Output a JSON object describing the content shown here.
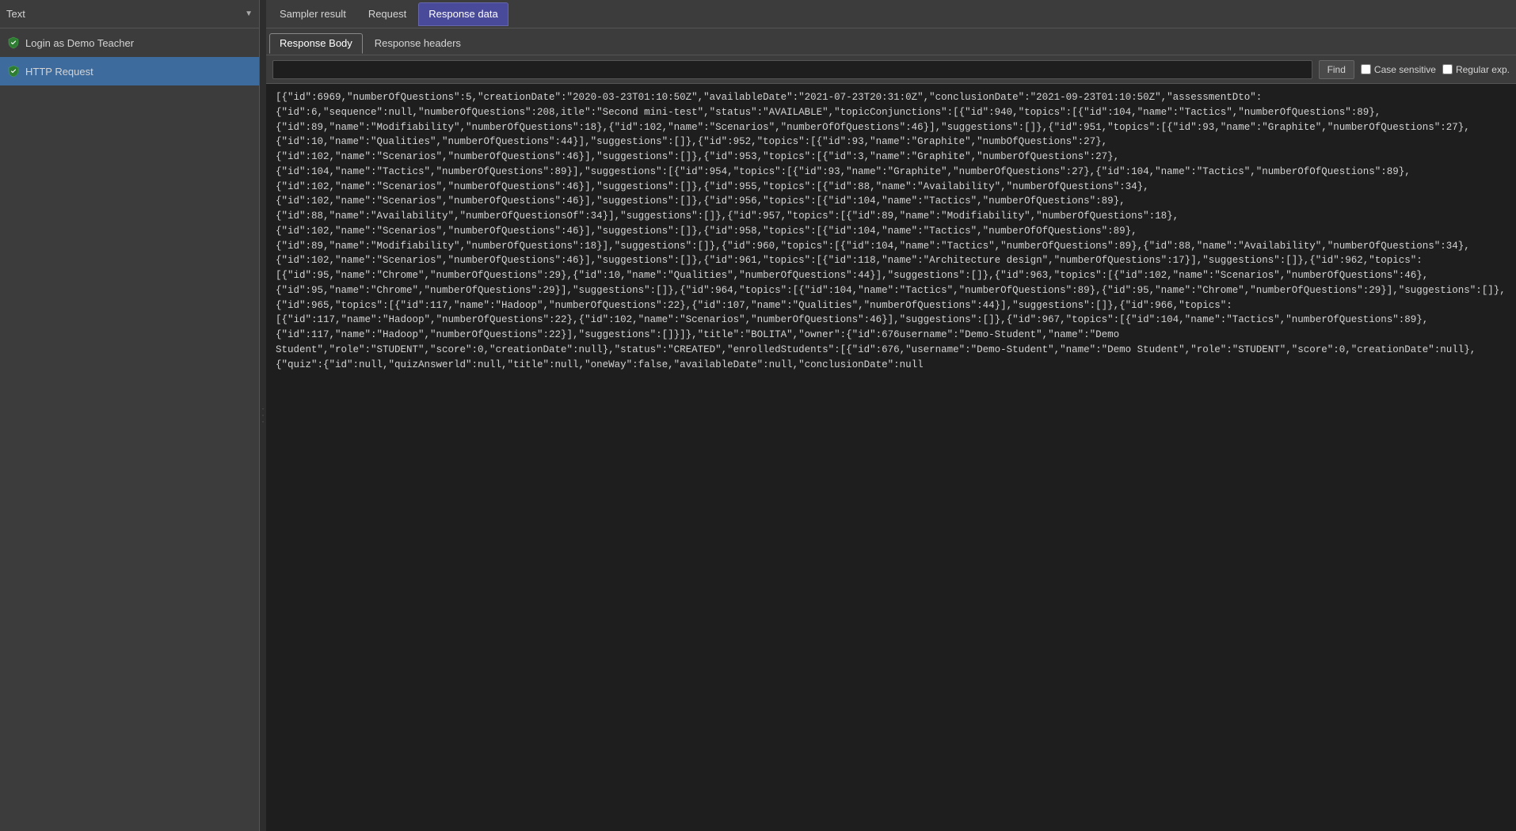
{
  "sidebar": {
    "title": "Text",
    "dropdown_arrow": "▼",
    "items": [
      {
        "id": "login-demo-teacher",
        "label": "Login as Demo Teacher",
        "active": false,
        "has_shield": true
      },
      {
        "id": "http-request",
        "label": "HTTP Request",
        "active": true,
        "has_shield": true
      }
    ]
  },
  "top_tabs": [
    {
      "id": "sampler-result",
      "label": "Sampler result",
      "active": false
    },
    {
      "id": "request",
      "label": "Request",
      "active": false
    },
    {
      "id": "response-data",
      "label": "Response data",
      "active": true
    }
  ],
  "sub_tabs": [
    {
      "id": "response-body",
      "label": "Response Body",
      "active": true
    },
    {
      "id": "response-headers",
      "label": "Response headers",
      "active": false
    }
  ],
  "search": {
    "placeholder": "",
    "find_label": "Find",
    "case_sensitive_label": "Case sensitive",
    "regex_label": "Regular exp."
  },
  "response_text": "[{\"id\":6969,\"numberOfQuestions\":5,\"creationDate\":\"2020-03-23T01:10:50Z\",\"availableDate\":\"2021-07-23T20:31:0Z\",\"conclusionDate\":\"2021-09-23T01:10:50Z\",\"assessmentDto\":{\"id\":6,\"sequence\":null,\"numberOfQuestions\":208,itle\":\"Second mini-test\",\"status\":\"AVAILABLE\",\"topicConjunctions\":[{\"id\":940,\"topics\":[{\"id\":104,\"name\":\"Tactics\",\"numberOfQuestions\":89},{\"id\":89,\"name\":\"Modifiability\",\"numberOfQuestions\":18},{\"id\":102,\"name\":\"Scenarios\",\"numberOfOfQuestions\":46}],\"suggestions\":[]},{\"id\":951,\"topics\":[{\"id\":93,\"name\":\"Graphite\",\"numberOfQuestions\":27},{\"id\":10,\"name\":\"Qualities\",\"numberOfQuestions\":44}],\"suggestions\":[]},{\"id\":952,\"topics\":[{\"id\":93,\"name\":\"Graphite\",\"numbOfQuestions\":27},{\"id\":102,\"name\":\"Scenarios\",\"numberOfQuestions\":46}],\"suggestions\":[]},{\"id\":953,\"topics\":[{\"id\":3,\"name\":\"Graphite\",\"numberOfQuestions\":27},{\"id\":104,\"name\":\"Tactics\",\"numberOfQuestions\":89}],\"suggestions\":[{\"id\":954,\"topics\":[{\"id\":93,\"name\":\"Graphite\",\"numberOfQuestions\":27},{\"id\":104,\"name\":\"Tactics\",\"numberOfOfQuestions\":89},{\"id\":102,\"name\":\"Scenarios\",\"numberOfQuestions\":46}],\"suggestions\":[]},{\"id\":955,\"topics\":[{\"id\":88,\"name\":\"Availability\",\"numberOfQuestions\":34},{\"id\":102,\"name\":\"Scenarios\",\"numberOfQuestions\":46}],\"suggestions\":[]},{\"id\":956,\"topics\":[{\"id\":104,\"name\":\"Tactics\",\"numberOfQuestions\":89},{\"id\":88,\"name\":\"Availability\",\"numberOfQuestionsOf\":34}],\"suggestions\":[]},{\"id\":957,\"topics\":[{\"id\":89,\"name\":\"Modifiability\",\"numberOfQuestions\":18},{\"id\":102,\"name\":\"Scenarios\",\"numberOfQuestions\":46}],\"suggestions\":[]},{\"id\":958,\"topics\":[{\"id\":104,\"name\":\"Tactics\",\"numberOfOfQuestions\":89},{\"id\":89,\"name\":\"Modifiability\",\"numberOfQuestions\":18}],\"suggestions\":[]},{\"id\":960,\"topics\":[{\"id\":104,\"name\":\"Tactics\",\"numberOfQuestions\":89},{\"id\":88,\"name\":\"Availability\",\"numberOfQuestions\":34},{\"id\":102,\"name\":\"Scenarios\",\"numberOfQuestions\":46}],\"suggestions\":[]},{\"id\":961,\"topics\":[{\"id\":118,\"name\":\"Architecture design\",\"numberOfQuestions\":17}],\"suggestions\":[]},{\"id\":962,\"topics\":[{\"id\":95,\"name\":\"Chrome\",\"numberOfQuestions\":29},{\"id\":10,\"name\":\"Qualities\",\"numberOfQuestions\":44}],\"suggestions\":[]},{\"id\":963,\"topics\":[{\"id\":102,\"name\":\"Scenarios\",\"numberOfQuestions\":46},{\"id\":95,\"name\":\"Chrome\",\"numberOfQuestions\":29}],\"suggestions\":[]},{\"id\":964,\"topics\":[{\"id\":104,\"name\":\"Tactics\",\"numberOfQuestions\":89},{\"id\":95,\"name\":\"Chrome\",\"numberOfQuestions\":29}],\"suggestions\":[]},{\"id\":965,\"topics\":[{\"id\":117,\"name\":\"Hadoop\",\"numberOfQuestions\":22},{\"id\":107,\"name\":\"Qualities\",\"numberOfQuestions\":44}],\"suggestions\":[]},{\"id\":966,\"topics\":[{\"id\":117,\"name\":\"Hadoop\",\"numberOfQuestions\":22},{\"id\":102,\"name\":\"Scenarios\",\"numberOfQuestions\":46}],\"suggestions\":[]},{\"id\":967,\"topics\":[{\"id\":104,\"name\":\"Tactics\",\"numberOfQuestions\":89},{\"id\":117,\"name\":\"Hadoop\",\"numberOfQuestions\":22}],\"suggestions\":[]}]},\"title\":\"BOLITA\",\"owner\":{\"id\":676username\":\"Demo-Student\",\"name\":\"Demo Student\",\"role\":\"STUDENT\",\"score\":0,\"creationDate\":null},\"status\":\"CREATED\",\"enrolledStudents\":[{\"id\":676,\"username\":\"Demo-Student\",\"name\":\"Demo Student\",\"role\":\"STUDENT\",\"score\":0,\"creationDate\":null},{\"quiz\":{\"id\":null,\"quizAnswerld\":null,\"title\":null,\"oneWay\":false,\"availableDate\":null,\"conclusionDate\":null"
}
